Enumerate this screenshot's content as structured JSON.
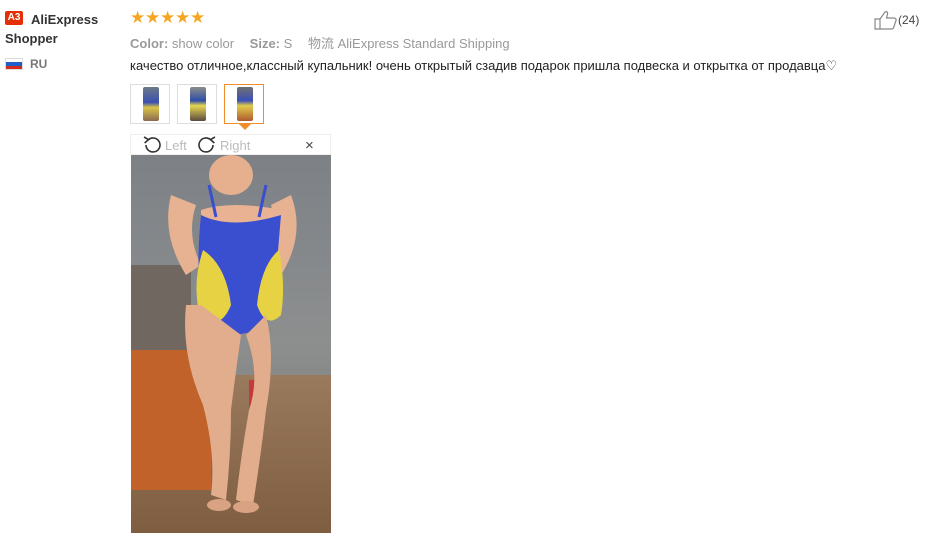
{
  "buyer": {
    "level_badge": "A3",
    "name": "AliExpress Shopper",
    "country": "RU",
    "flag_colors": [
      "#ffffff",
      "#1f5fc8",
      "#d52b1e"
    ]
  },
  "review": {
    "rating": 5,
    "stars": "★★★★★",
    "color_label": "Color:",
    "color_value": "show color",
    "size_label": "Size:",
    "size_value": "S",
    "shipping_label": "物流",
    "shipping_value": "AliExpress Standard Shipping",
    "text": "качество отличное,классный купальник! очень открытый сзадив подарок пришла подвеска и открытка от продавца♡",
    "helpful_count": "(24)"
  },
  "viewer": {
    "rotate_left": "Left",
    "rotate_right": "Right",
    "close": "×"
  },
  "thumbnails": [
    {
      "name": "photo-1",
      "active": false
    },
    {
      "name": "photo-2",
      "active": false
    },
    {
      "name": "photo-3",
      "active": true
    }
  ],
  "colors": {
    "star": "#f5a623",
    "accent": "#f08c29",
    "badge": "#e62e04"
  }
}
